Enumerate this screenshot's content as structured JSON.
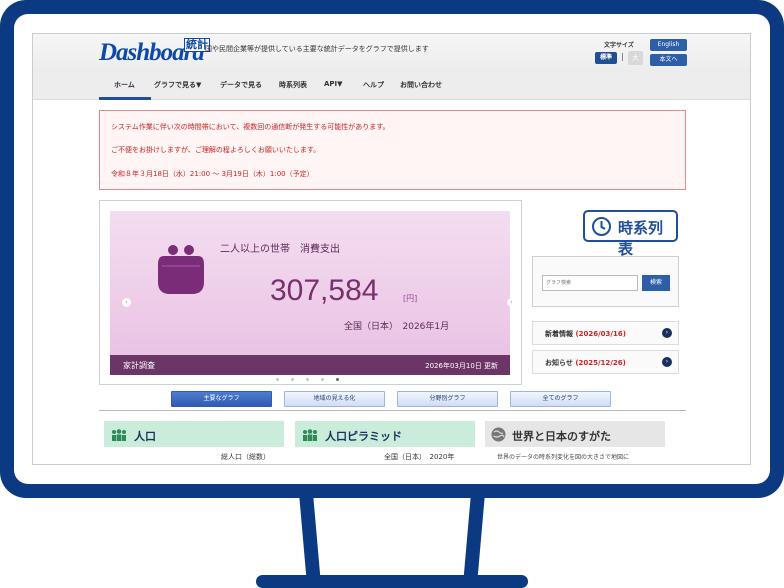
{
  "header": {
    "logo_text": "Dashboard",
    "logo_kanji": "統計",
    "tagline": "国や民間企業等が提供している主要な統計データをグラフで提供します",
    "font_size_label": "文字サイズ",
    "font_standard": "標準",
    "font_separator": "|",
    "font_large": "大",
    "english_btn": "English",
    "content_btn": "本文へ"
  },
  "nav": {
    "items": [
      "ホーム",
      "グラフで見る▼",
      "データで見る",
      "時系列表",
      "API▼",
      "ヘルプ",
      "お問い合わせ"
    ]
  },
  "alert": {
    "line1": "システム作業に伴い次の時間帯において、複数回の通信断が発生する可能性があります。",
    "line2": "ご不便をお掛けしますが、ご理解の程よろしくお願いいたします。",
    "line3": "令和８年３月18日（水）21:00 〜 3月19日（木）1:00（予定）"
  },
  "slide": {
    "title": "二人以上の世帯　消費支出",
    "value": "307,584",
    "unit": "[円]",
    "subtitle": "全国（日本）　2026年1月",
    "category": "家計調査",
    "updated": "2026年03月10日 更新",
    "prev_arrow": "‹",
    "next_arrow": "›",
    "dot_count": 5,
    "active_dot": 4
  },
  "sidebar": {
    "timeseries_label": "時系列表",
    "search_placeholder": "グラフ検索",
    "search_button": "検索",
    "news_label": "新着情報",
    "news_date": "(2026/03/16)",
    "notice_label": "お知らせ",
    "notice_date": "(2025/12/26)",
    "arrow": "›"
  },
  "tabs": [
    "主要なグラフ",
    "地域の見える化",
    "分野別グラフ",
    "全てのグラフ"
  ],
  "cards": [
    {
      "title": "人口",
      "sub": "総人口（総数）",
      "color": "#c9ecdb"
    },
    {
      "title": "人口ピラミッド",
      "sub": "全国（日本）　2020年",
      "color": "#c9ecdb"
    },
    {
      "title": "世界と日本のすがた",
      "sub": "世界のデータの時系列変化を図の大きさで地図に",
      "color": "#e6e6e6"
    }
  ],
  "colors": {
    "frame": "#0b3a82",
    "brand": "#1f4f99",
    "alert_text": "#cc2222",
    "slide_accent": "#79306f"
  }
}
